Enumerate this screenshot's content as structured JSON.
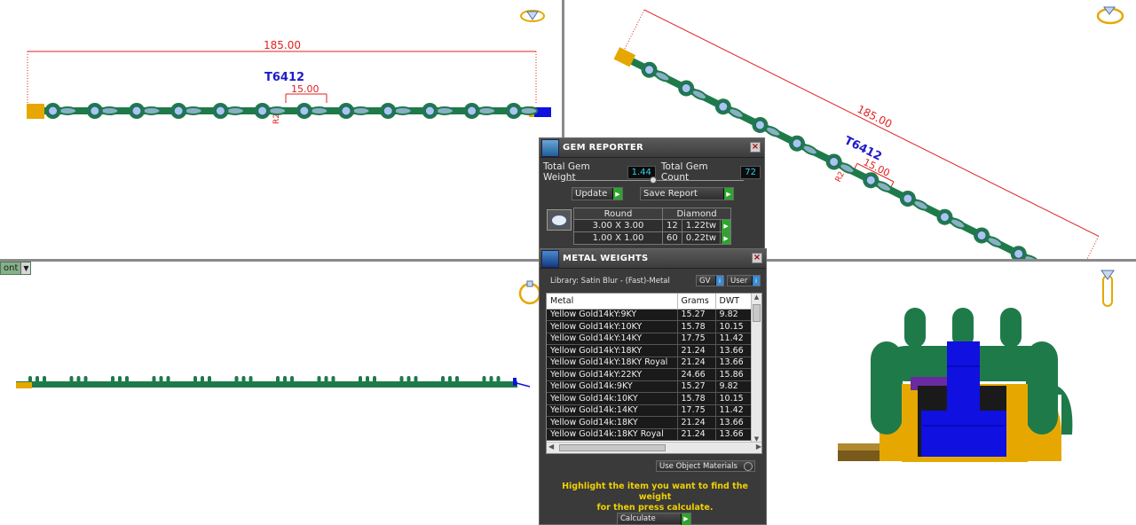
{
  "viewports": {
    "top": {
      "dimension_length": "185.00",
      "model_label": "T6412",
      "dimension_spacing": "15.00",
      "dimension_small": "R2",
      "view_icon": "gem-top-view-icon"
    },
    "perspective": {
      "dimension_length": "185.00",
      "model_label": "T6412",
      "dimension_spacing": "15.00",
      "dimension_small": "R2",
      "view_icon": "ring-perspective-view-icon"
    },
    "front": {
      "view_label": "ont",
      "view_icon": "ring-front-view-icon"
    },
    "right": {
      "view_icon": "ring-side-view-icon"
    }
  },
  "gem_reporter": {
    "title": "GEM REPORTER",
    "total_weight_label": "Total Gem Weight",
    "total_weight_value": "1.44",
    "total_count_label": "Total Gem Count",
    "total_count_value": "72",
    "update_label": "Update",
    "save_report_label": "Save Report",
    "gem_table": {
      "shape": "Round",
      "material": "Diamond",
      "rows": [
        {
          "size": "3.00 X 3.00",
          "count": "12",
          "weight": "1.22tw"
        },
        {
          "size": "1.00 X 1.00",
          "count": "60",
          "weight": "0.22tw"
        }
      ]
    }
  },
  "metal_weights": {
    "title": "METAL WEIGHTS",
    "library": "Library: Satin Blur - (Fast)-Metal",
    "gv_label": "GV",
    "user_label": "User",
    "columns": [
      "Metal",
      "Grams",
      "DWT"
    ],
    "rows": [
      [
        "Yellow Gold14kY:9KY",
        "15.27",
        "9.82"
      ],
      [
        "Yellow Gold14kY:10KY",
        "15.78",
        "10.15"
      ],
      [
        "Yellow Gold14kY:14KY",
        "17.75",
        "11.42"
      ],
      [
        "Yellow Gold14kY:18KY",
        "21.24",
        "13.66"
      ],
      [
        "Yellow Gold14kY:18KY Royal",
        "21.24",
        "13.66"
      ],
      [
        "Yellow Gold14kY:22KY",
        "24.66",
        "15.86"
      ],
      [
        "Yellow Gold14k:9KY",
        "15.27",
        "9.82"
      ],
      [
        "Yellow Gold14k:10KY",
        "15.78",
        "10.15"
      ],
      [
        "Yellow Gold14k:14KY",
        "17.75",
        "11.42"
      ],
      [
        "Yellow Gold14k:18KY",
        "21.24",
        "13.66"
      ],
      [
        "Yellow Gold14k:18KY Royal",
        "21.24",
        "13.66"
      ]
    ],
    "use_object_materials_label": "Use Object Materials",
    "hint_line1": "Highlight the item you want to find the weight",
    "hint_line2": "for then press calculate.",
    "calculate_label": "Calculate"
  },
  "colors": {
    "metal_green": "#1f7a4a",
    "gold": "#e6a800",
    "blue": "#1010e0",
    "dimension_red": "#e02020",
    "label_blue": "#1c1cc8",
    "panel_bg": "#3a3a3a",
    "hint_yellow": "#f0d000"
  }
}
